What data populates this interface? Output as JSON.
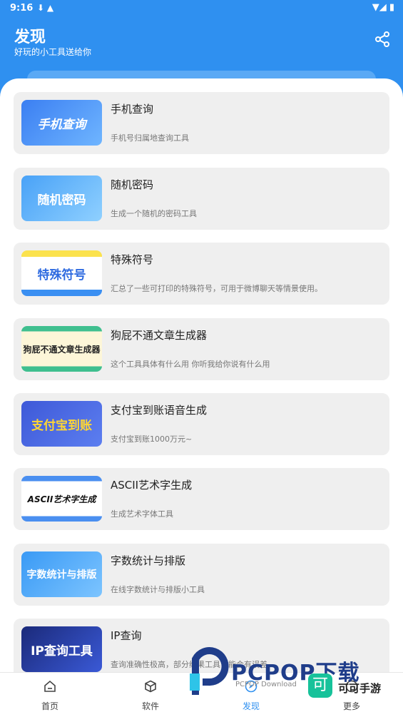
{
  "status_bar": {
    "time": "9:16",
    "left_icons": "⬇ ▲",
    "right_icons": "▼◢ ▮"
  },
  "header": {
    "title": "发现",
    "subtitle": "好玩的小工具送给你",
    "share_icon": "share-icon"
  },
  "colors": {
    "primary": "#2f90f0",
    "card_bg": "#efefef"
  },
  "tools": [
    {
      "title": "手机查询",
      "desc": "手机号归属地查询工具",
      "thumb_text": "手机查询"
    },
    {
      "title": "随机密码",
      "desc": "生成一个随机的密码工具",
      "thumb_text": "随机密码"
    },
    {
      "title": "特殊符号",
      "desc": "汇总了一些可打印的特殊符号，可用于微博聊天等情景使用。",
      "thumb_text": "特殊符号"
    },
    {
      "title": "狗屁不通文章生成器",
      "desc": "这个工具具体有什么用 你听我给你说有什么用",
      "thumb_text": "狗屁不通文章生成器"
    },
    {
      "title": "支付宝到账语音生成",
      "desc": "支付宝到账1000万元~",
      "thumb_text": "支付宝到账"
    },
    {
      "title": "ASCII艺术字生成",
      "desc": "生成艺术字体工具",
      "thumb_text": "ASCII艺术字生成"
    },
    {
      "title": "字数统计与排版",
      "desc": "在线字数统计与排版小工具",
      "thumb_text": "字数统计与排版"
    },
    {
      "title": "IP查询",
      "desc": "查询准确性极高，部分结果工具可能会有误差",
      "thumb_text": "IP查询工具"
    }
  ],
  "bottom_nav": [
    {
      "label": "首页",
      "icon": "home-icon"
    },
    {
      "label": "软件",
      "icon": "cube-icon"
    },
    {
      "label": "发现",
      "icon": "compass-icon",
      "active": true
    },
    {
      "label": "更多",
      "icon": "more-icon"
    }
  ],
  "watermark": {
    "brand": "PCPOP下载",
    "sub": "PCPOP Download",
    "app_name": "可可手游",
    "app_logo": "可"
  }
}
